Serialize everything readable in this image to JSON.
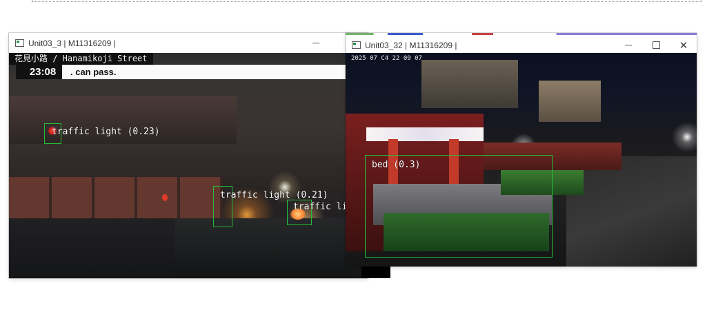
{
  "windows": [
    {
      "title": "Unit03_3 | M11316209 |",
      "overlay": {
        "street_name": "花見小路 / Hanamikoji Street",
        "clock": "23:08",
        "banner": ". can pass."
      },
      "detections": [
        {
          "label": "traffic light (0.23)"
        },
        {
          "label": "traffic light (0.21)"
        },
        {
          "label": "traffic lig"
        }
      ],
      "controls": {
        "minimize": "minimize"
      }
    },
    {
      "title": "Unit03_32 | M11316209 |",
      "overlay": {
        "timestamp": "2025 07 C4 22 09 07"
      },
      "detections": [
        {
          "label": "bed (0.3)"
        }
      ],
      "controls": {
        "minimize": "minimize",
        "maximize": "maximize",
        "close": "close"
      }
    }
  ],
  "colors": {
    "detection_box": "#22c03a",
    "titlebar_bg": "#ffffff"
  },
  "icons": [
    "app-icon",
    "minimize-icon",
    "maximize-icon",
    "close-icon"
  ]
}
